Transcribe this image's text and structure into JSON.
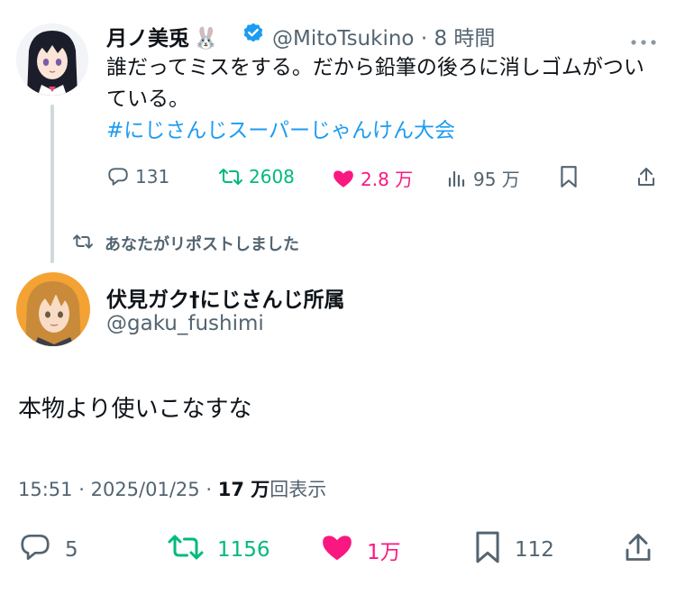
{
  "quoted_tweet": {
    "author_name": "月ノ美兎",
    "author_emoji": "🐰",
    "handle": "@MitoTsukino",
    "separator": "·",
    "time_ago": "8 時間",
    "text": "誰だってミスをする。だから鉛筆の後ろに消しゴムがついている。",
    "hashtag": "#にじさんじスーパーじゃんけん大会",
    "actions": {
      "replies": "131",
      "reposts": "2608",
      "likes": "2.8 万",
      "views": "95 万"
    }
  },
  "repost_note": "あなたがリポストしました",
  "main_tweet": {
    "author_name": "伏見ガク†にじさんじ所属",
    "handle": "@gaku_fushimi",
    "text": "本物より使いこなすな",
    "time": "15:51",
    "separator": "·",
    "date": "2025/01/25",
    "separator2": "·",
    "views_count": "17 万",
    "views_label": "回表示",
    "actions": {
      "replies": "5",
      "reposts": "1156",
      "likes": "1万",
      "bookmarks": "112"
    }
  },
  "colors": {
    "text": "#0f1419",
    "muted": "#536471",
    "link": "#1d9bf0",
    "repost_green": "#00ba7c",
    "like_pink": "#f91880",
    "verified_blue": "#1d9bf0"
  },
  "icons": {
    "reply": "reply-icon",
    "repost": "repost-icon",
    "like": "heart-icon",
    "views": "views-icon",
    "bookmark": "bookmark-icon",
    "share": "share-icon",
    "more": "more-icon",
    "verified": "verified-badge-icon"
  }
}
